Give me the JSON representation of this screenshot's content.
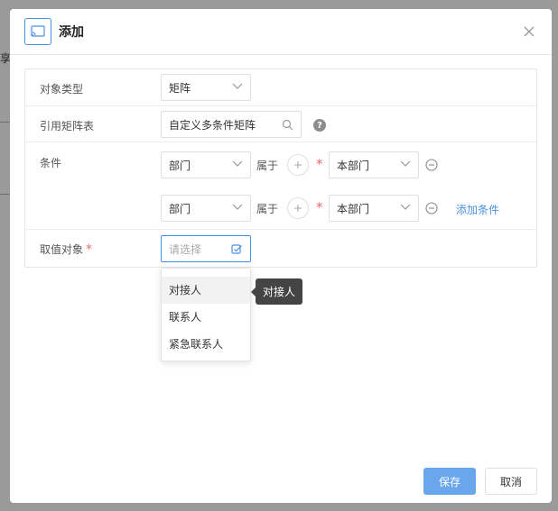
{
  "background": {
    "fragment_text": "享"
  },
  "modal": {
    "title": "添加",
    "icon": "cast-icon",
    "close_icon": "close-icon"
  },
  "form": {
    "object_type": {
      "label": "对象类型",
      "value": "矩阵"
    },
    "matrix_table": {
      "label": "引用矩阵表",
      "value": "自定义多条件矩阵"
    },
    "condition": {
      "label": "条件",
      "rows": [
        {
          "field": "部门",
          "operator": "属于",
          "value": "本部门"
        },
        {
          "field": "部门",
          "operator": "属于",
          "value": "本部门"
        }
      ],
      "add_label": "添加条件"
    },
    "value_object": {
      "label": "取值对象",
      "required": "*",
      "placeholder": "请选择"
    }
  },
  "dropdown": {
    "options": [
      "对接人",
      "联系人",
      "紧急联系人"
    ]
  },
  "tooltip": {
    "text": "对接人"
  },
  "footer": {
    "save_label": "保存",
    "cancel_label": "取消"
  },
  "colors": {
    "primary": "#6aa6ec",
    "accent": "#4a90e2",
    "required": "#f56c6c"
  }
}
